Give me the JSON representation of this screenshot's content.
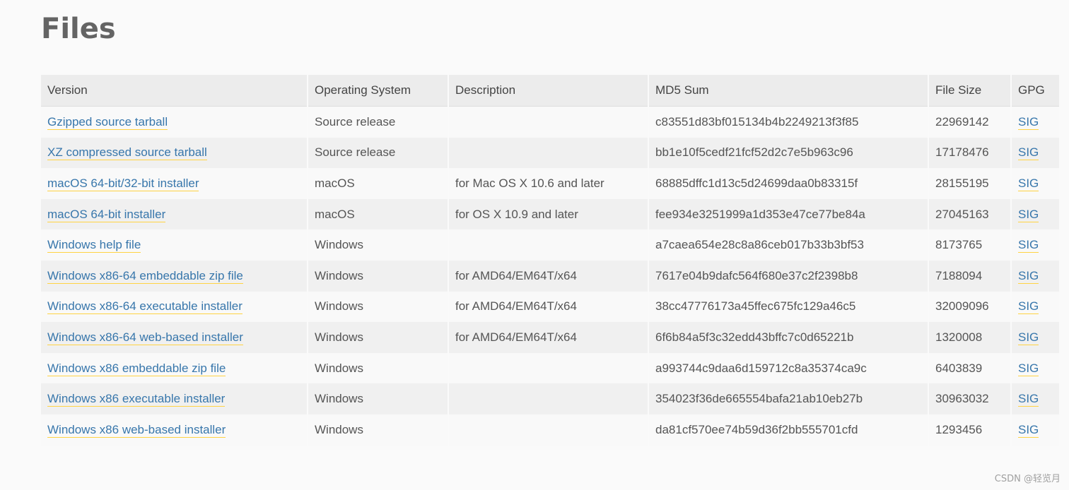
{
  "page": {
    "title": "Files"
  },
  "table": {
    "headers": [
      "Version",
      "Operating System",
      "Description",
      "MD5 Sum",
      "File Size",
      "GPG"
    ],
    "rows": [
      {
        "version": "Gzipped source tarball",
        "os": "Source release",
        "description": "",
        "md5": "c83551d83bf015134b4b2249213f3f85",
        "size": "22969142",
        "gpg": "SIG"
      },
      {
        "version": "XZ compressed source tarball",
        "os": "Source release",
        "description": "",
        "md5": "bb1e10f5cedf21fcf52d2c7e5b963c96",
        "size": "17178476",
        "gpg": "SIG"
      },
      {
        "version": "macOS 64-bit/32-bit installer",
        "os": "macOS",
        "description": "for Mac OS X 10.6 and later",
        "md5": "68885dffc1d13c5d24699daa0b83315f",
        "size": "28155195",
        "gpg": "SIG"
      },
      {
        "version": "macOS 64-bit installer",
        "os": "macOS",
        "description": "for OS X 10.9 and later",
        "md5": "fee934e3251999a1d353e47ce77be84a",
        "size": "27045163",
        "gpg": "SIG"
      },
      {
        "version": "Windows help file",
        "os": "Windows",
        "description": "",
        "md5": "a7caea654e28c8a86ceb017b33b3bf53",
        "size": "8173765",
        "gpg": "SIG"
      },
      {
        "version": "Windows x86-64 embeddable zip file",
        "os": "Windows",
        "description": "for AMD64/EM64T/x64",
        "md5": "7617e04b9dafc564f680e37c2f2398b8",
        "size": "7188094",
        "gpg": "SIG"
      },
      {
        "version": "Windows x86-64 executable installer",
        "os": "Windows",
        "description": "for AMD64/EM64T/x64",
        "md5": "38cc47776173a45ffec675fc129a46c5",
        "size": "32009096",
        "gpg": "SIG"
      },
      {
        "version": "Windows x86-64 web-based installer",
        "os": "Windows",
        "description": "for AMD64/EM64T/x64",
        "md5": "6f6b84a5f3c32edd43bffc7c0d65221b",
        "size": "1320008",
        "gpg": "SIG"
      },
      {
        "version": "Windows x86 embeddable zip file",
        "os": "Windows",
        "description": "",
        "md5": "a993744c9daa6d159712c8a35374ca9c",
        "size": "6403839",
        "gpg": "SIG"
      },
      {
        "version": "Windows x86 executable installer",
        "os": "Windows",
        "description": "",
        "md5": "354023f36de665554bafa21ab10eb27b",
        "size": "30963032",
        "gpg": "SIG"
      },
      {
        "version": "Windows x86 web-based installer",
        "os": "Windows",
        "description": "",
        "md5": "da81cf570ee74b59d36f2bb555701cfd",
        "size": "1293456",
        "gpg": "SIG"
      }
    ]
  },
  "watermark": "CSDN @轻览月",
  "colors": {
    "link": "#3776ab",
    "link_underline": "#ffd343",
    "header_bg": "#ececec",
    "row_odd": "#f9f9f9",
    "row_even": "#f0f0f0"
  }
}
